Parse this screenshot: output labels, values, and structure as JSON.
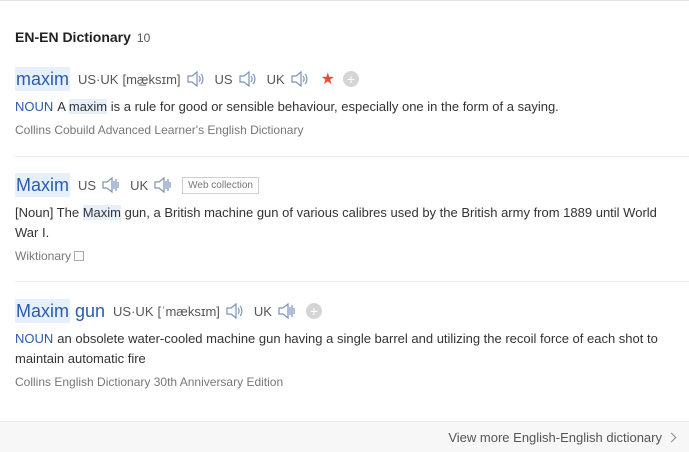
{
  "header": {
    "title": "EN-EN Dictionary",
    "count": "10"
  },
  "entries": [
    {
      "word": "maxim",
      "phon_label": "US·UK",
      "phonetic": "[mæ̲ksɪm]",
      "us_label": "US",
      "uk_label": "UK",
      "pos": "NOUN",
      "def_pre": "A ",
      "def_hl": "maxim",
      "def_post": " is a rule for good or sensible behaviour, especially one in the form of a saying.",
      "source": "Collins Cobuild Advanced Learner's English Dictionary"
    },
    {
      "word": "Maxim",
      "us_label": "US",
      "uk_label": "UK",
      "tag": "Web collection",
      "def_pre": "[Noun] The ",
      "def_hl": "Maxim",
      "def_post": " gun, a British machine gun of various calibres used by the British army from 1889 until World War I.",
      "source": "Wiktionary"
    },
    {
      "word_a": "Maxim",
      "word_b": "gun",
      "phon_label": "US·UK",
      "phonetic": "[ˈmæksɪm]",
      "uk_label": "UK",
      "pos": "NOUN",
      "def": "an obsolete water-cooled machine gun having a single barrel and utilizing the recoil force of each shot to maintain automatic fire",
      "source": "Collins English Dictionary 30th Anniversary Edition"
    }
  ],
  "footer": {
    "more_label": "View more English-English dictionary"
  },
  "colors": {
    "link": "#2a5caa",
    "highlight": "#e6f0fb",
    "star": "#e84c3d"
  },
  "icons": {
    "speaker": "speaker-icon",
    "star": "star-icon",
    "add": "plus-icon"
  }
}
